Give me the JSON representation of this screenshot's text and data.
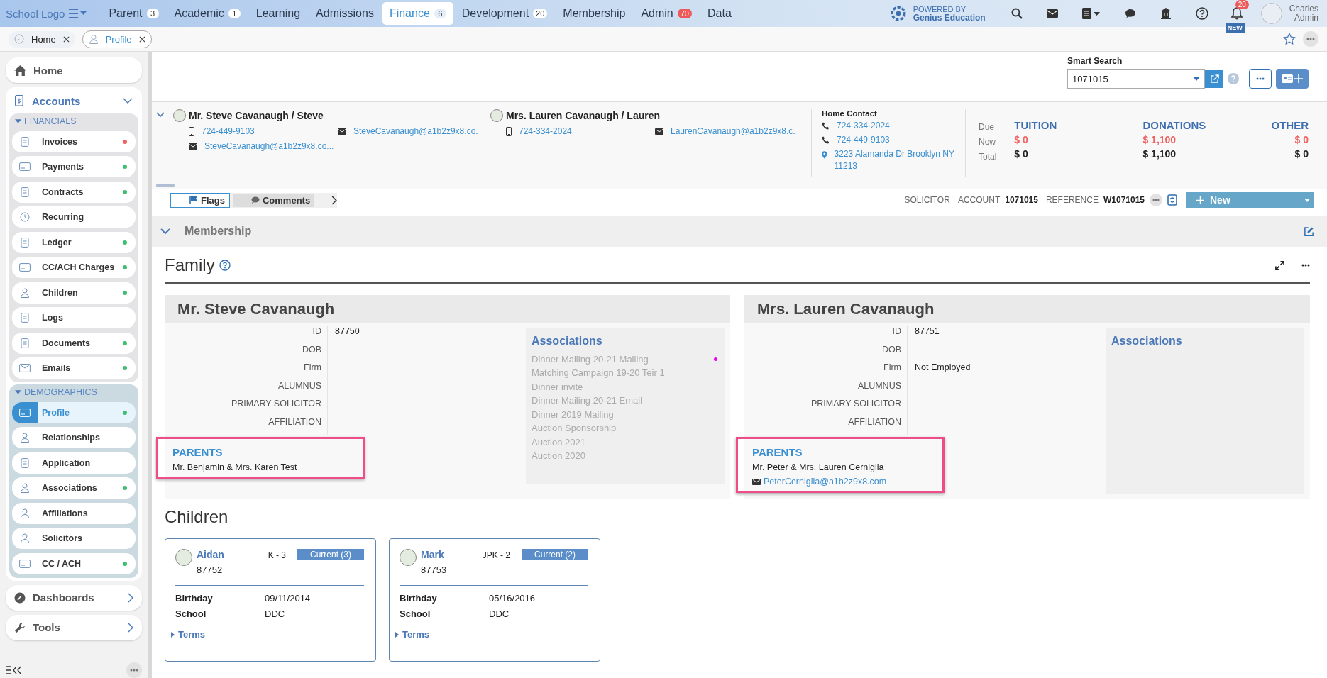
{
  "top_nav": {
    "logo": "School Logo",
    "tabs": [
      {
        "label": "Parent",
        "badge": "3",
        "alert": false,
        "selected": false
      },
      {
        "label": "Academic",
        "badge": "1",
        "alert": false,
        "selected": false
      },
      {
        "label": "Learning",
        "selected": false
      },
      {
        "label": "Admissions",
        "selected": false
      },
      {
        "label": "Finance",
        "badge": "6",
        "alert": false,
        "selected": true
      },
      {
        "label": "Development",
        "badge": "20",
        "alert": false,
        "selected": false
      },
      {
        "label": "Membership",
        "selected": false
      },
      {
        "label": "Admin",
        "badge": "70",
        "alert": true,
        "selected": false
      },
      {
        "label": "Data",
        "selected": false
      }
    ],
    "powered_by": "POWERED BY",
    "brand": "Genius Education",
    "notification_count": "20",
    "notification_tag": "NEW",
    "user_first": "Charles",
    "user_last": "Admin"
  },
  "open_tabs": [
    {
      "label": "Home",
      "selected": false
    },
    {
      "label": "Profile",
      "selected": true
    }
  ],
  "sidebar": {
    "home": "Home",
    "accounts": "Accounts",
    "groups": [
      {
        "title": "FINANCIALS",
        "items": [
          {
            "label": "Invoices",
            "selected": false,
            "color": "#f06262"
          },
          {
            "label": "Payments",
            "selected": false,
            "color": "#3cc070"
          },
          {
            "label": "Contracts",
            "selected": false,
            "color": "#3cc070"
          },
          {
            "label": "Recurring",
            "selected": false
          },
          {
            "label": "Ledger",
            "selected": false,
            "color": "#3cc070"
          },
          {
            "label": "CC/ACH Charges",
            "selected": false,
            "color": "#3cc070"
          },
          {
            "label": "Children",
            "selected": false,
            "color": "#3cc070"
          },
          {
            "label": "Logs",
            "selected": false
          },
          {
            "label": "Documents",
            "selected": false,
            "color": "#3cc070"
          },
          {
            "label": "Emails",
            "selected": false,
            "color": "#3cc070"
          }
        ]
      },
      {
        "title": "DEMOGRAPHICS",
        "items": [
          {
            "label": "Profile",
            "selected": true,
            "color": "#3cc070"
          },
          {
            "label": "Relationships",
            "selected": false
          },
          {
            "label": "Application",
            "selected": false
          },
          {
            "label": "Associations",
            "selected": false,
            "color": "#3cc070"
          },
          {
            "label": "Affiliations",
            "selected": false
          },
          {
            "label": "Solicitors",
            "selected": false
          },
          {
            "label": "CC / ACH",
            "selected": false,
            "color": "#3cc070"
          }
        ]
      }
    ],
    "dashboards": "Dashboards",
    "tools": "Tools"
  },
  "smart_search": {
    "label": "Smart Search",
    "value": "1071015"
  },
  "contacts": [
    {
      "name": "Mr. Steve Cavanaugh / Steve",
      "lines": [
        {
          "kind": "phone",
          "text": "724-449-9103"
        },
        {
          "kind": "email",
          "text": "SteveCavanaugh@a1b2z9x8.co."
        },
        {
          "kind": "email",
          "text": "SteveCavanaugh@a1b2z9x8.co..."
        }
      ]
    },
    {
      "name": "Mrs. Lauren Cavanaugh / Lauren",
      "lines": [
        {
          "kind": "phone",
          "text": "724-334-2024"
        },
        {
          "kind": "email",
          "text": "LaurenCavanaugh@a1b2z9x8.c."
        }
      ]
    }
  ],
  "home_contact": {
    "title": "Home Contact",
    "lines": [
      {
        "kind": "phone",
        "text": "724-334-2024"
      },
      {
        "kind": "phone",
        "text": "724-449-9103"
      },
      {
        "kind": "address",
        "text": "3223 Alamanda Dr Brooklyn NY 11213"
      }
    ]
  },
  "balances": {
    "row_labels": [
      "Due",
      "Now",
      "Total"
    ],
    "columns": [
      {
        "title": "TUITION",
        "now": "$ 0",
        "total": "$ 0"
      },
      {
        "title": "DONATIONS",
        "now": "$ 1,100",
        "total": "$ 1,100"
      },
      {
        "title": "OTHER",
        "now": "$ 0",
        "total": "$ 0"
      }
    ]
  },
  "account_bar": {
    "tabs": [
      {
        "label": "Flags",
        "selected": true
      },
      {
        "label": "Comments",
        "selected": false
      }
    ],
    "solicitor": "SOLICITOR",
    "account_label": "ACCOUNT",
    "account": "1071015",
    "reference_label": "REFERENCE",
    "reference": "W1071015",
    "new_button": "New"
  },
  "membership": {
    "title": "Membership"
  },
  "family": {
    "title": "Family",
    "persons": [
      {
        "name": "Mr. Steve Cavanaugh",
        "fields": [
          {
            "label": "ID",
            "value": "87750"
          },
          {
            "label": "DOB"
          },
          {
            "label": "Firm"
          },
          {
            "label": "ALUMNUS"
          },
          {
            "label": "PRIMARY SOLICITOR"
          },
          {
            "label": "AFFILIATION"
          }
        ],
        "associations_title": "Associations",
        "associations": [
          {
            "label": "Dinner Mailing 20-21 Mailing",
            "color": "#ee00ee"
          },
          {
            "label": "Matching Campaign 19-20 Teir 1"
          },
          {
            "label": "Dinner invite"
          },
          {
            "label": "Dinner Mailing 20-21 Email"
          },
          {
            "label": "Dinner 2019 Mailing"
          },
          {
            "label": "Auction Sponsorship"
          },
          {
            "label": "Auction 2021"
          },
          {
            "label": "Auction 2020"
          }
        ],
        "parents": {
          "title": "PARENTS",
          "names": "Mr. Benjamin & Mrs. Karen Test"
        }
      },
      {
        "name": "Mrs. Lauren Cavanaugh",
        "fields": [
          {
            "label": "ID",
            "value": "87751"
          },
          {
            "label": "DOB"
          },
          {
            "label": "Firm",
            "value": "Not Employed"
          },
          {
            "label": "ALUMNUS"
          },
          {
            "label": "PRIMARY SOLICITOR"
          },
          {
            "label": "AFFILIATION"
          }
        ],
        "associations_title": "Associations",
        "parents": {
          "title": "PARENTS",
          "names": "Mr. Peter & Mrs. Lauren Cerniglia",
          "email": "PeterCerniglia@a1b2z9x8.com"
        }
      }
    ]
  },
  "children": {
    "title": "Children",
    "cards": [
      {
        "name": "Aidan",
        "id": "87752",
        "grade": "K - 3",
        "status": "Current  (3)",
        "birthday_label": "Birthday",
        "birthday": "09/11/2014",
        "school_label": "School",
        "school": "DDC",
        "terms": "Terms"
      },
      {
        "name": "Mark",
        "id": "87753",
        "grade": "JPK - 2",
        "status": "Current  (2)",
        "birthday_label": "Birthday",
        "birthday": "05/16/2016",
        "school_label": "School",
        "school": "DDC",
        "terms": "Terms"
      }
    ]
  }
}
